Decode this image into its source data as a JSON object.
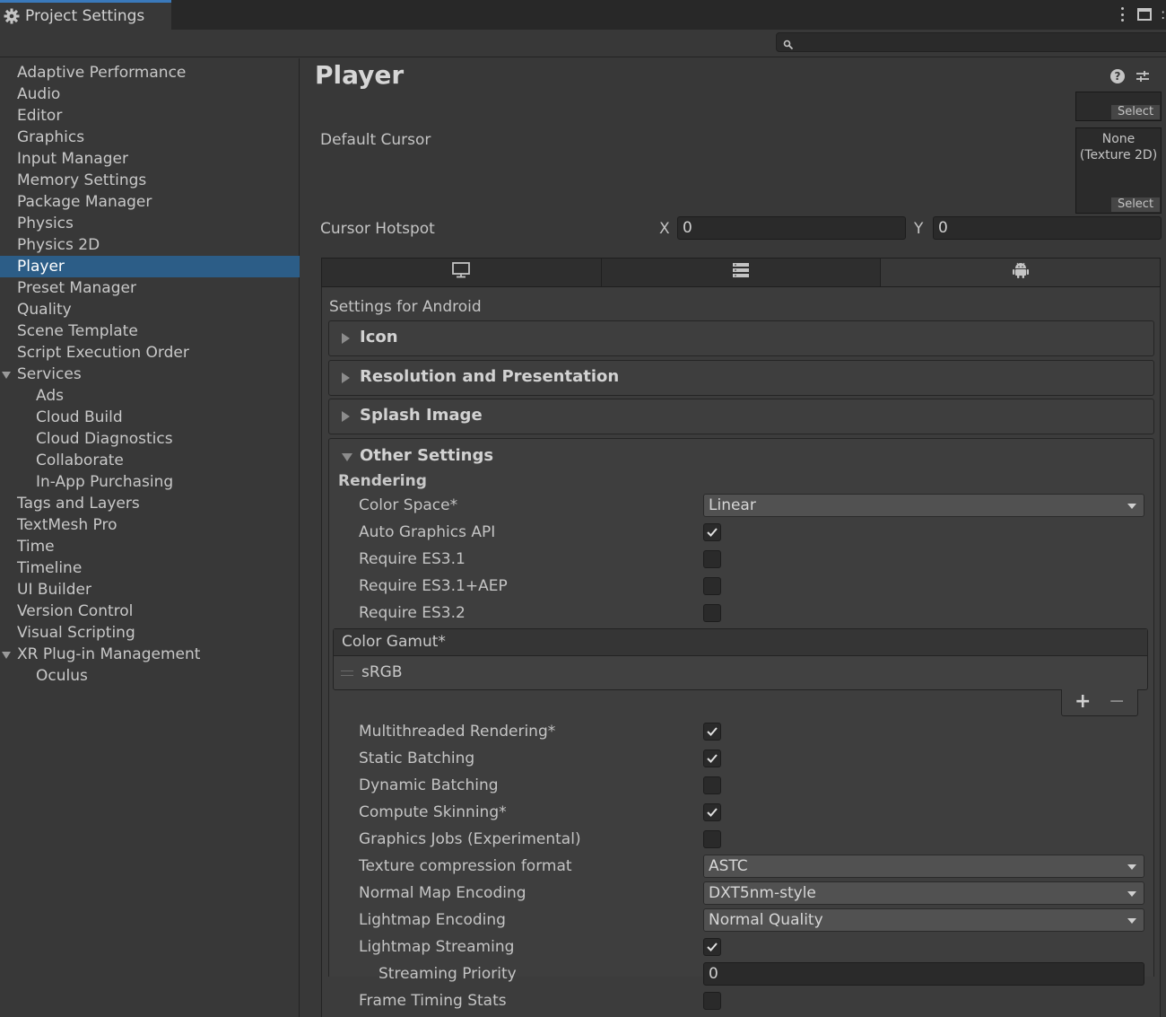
{
  "window": {
    "tab_title": "Project Settings",
    "search_placeholder": ""
  },
  "sidebar": {
    "items": [
      {
        "label": "Adaptive Performance"
      },
      {
        "label": "Audio"
      },
      {
        "label": "Editor"
      },
      {
        "label": "Graphics"
      },
      {
        "label": "Input Manager"
      },
      {
        "label": "Memory Settings"
      },
      {
        "label": "Package Manager"
      },
      {
        "label": "Physics"
      },
      {
        "label": "Physics 2D"
      },
      {
        "label": "Player",
        "selected": true
      },
      {
        "label": "Preset Manager"
      },
      {
        "label": "Quality"
      },
      {
        "label": "Scene Template"
      },
      {
        "label": "Script Execution Order"
      },
      {
        "label": "Services",
        "expanded": true
      },
      {
        "label": "Ads",
        "child": true
      },
      {
        "label": "Cloud Build",
        "child": true
      },
      {
        "label": "Cloud Diagnostics",
        "child": true
      },
      {
        "label": "Collaborate",
        "child": true
      },
      {
        "label": "In-App Purchasing",
        "child": true
      },
      {
        "label": "Tags and Layers"
      },
      {
        "label": "TextMesh Pro"
      },
      {
        "label": "Time"
      },
      {
        "label": "Timeline"
      },
      {
        "label": "UI Builder"
      },
      {
        "label": "Version Control"
      },
      {
        "label": "Visual Scripting"
      },
      {
        "label": "XR Plug-in Management",
        "expanded": true
      },
      {
        "label": "Oculus",
        "child": true
      }
    ]
  },
  "main": {
    "title": "Player",
    "help_glyph": "?",
    "top_texture": {
      "select_label": "Select"
    },
    "default_cursor": {
      "label": "Default Cursor",
      "texture_name": "None\n(Texture 2D)",
      "select_label": "Select"
    },
    "cursor_hotspot": {
      "label": "Cursor Hotspot",
      "x_label": "X",
      "x_value": "0",
      "y_label": "Y",
      "y_value": "0"
    },
    "platform_tabs": [
      {
        "name": "standalone",
        "icon": "monitor-icon"
      },
      {
        "name": "server",
        "icon": "server-icon"
      },
      {
        "name": "android",
        "icon": "android-icon",
        "active": true
      }
    ],
    "settings_for": "Settings for Android",
    "sections": {
      "icon": "Icon",
      "resolution": "Resolution and Presentation",
      "splash": "Splash Image",
      "other": "Other Settings"
    },
    "other_settings": {
      "rendering_header": "Rendering",
      "color_space": {
        "label": "Color Space*",
        "value": "Linear"
      },
      "auto_graphics_api": {
        "label": "Auto Graphics API",
        "checked": true
      },
      "require_es31": {
        "label": "Require ES3.1",
        "checked": false
      },
      "require_es31_aep": {
        "label": "Require ES3.1+AEP",
        "checked": false
      },
      "require_es32": {
        "label": "Require ES3.2",
        "checked": false
      },
      "color_gamut": {
        "header": "Color Gamut*",
        "items": [
          "sRGB"
        ],
        "add": "+",
        "remove": "−"
      },
      "multithreaded_rendering": {
        "label": "Multithreaded Rendering*",
        "checked": true
      },
      "static_batching": {
        "label": "Static Batching",
        "checked": true
      },
      "dynamic_batching": {
        "label": "Dynamic Batching",
        "checked": false
      },
      "compute_skinning": {
        "label": "Compute Skinning*",
        "checked": true
      },
      "graphics_jobs": {
        "label": "Graphics Jobs (Experimental)",
        "checked": false
      },
      "texture_compression": {
        "label": "Texture compression format",
        "value": "ASTC"
      },
      "normal_map_encoding": {
        "label": "Normal Map Encoding",
        "value": "DXT5nm-style"
      },
      "lightmap_encoding": {
        "label": "Lightmap Encoding",
        "value": "Normal Quality"
      },
      "lightmap_streaming": {
        "label": "Lightmap Streaming",
        "checked": true
      },
      "streaming_priority": {
        "label": "Streaming Priority",
        "value": "0"
      },
      "frame_timing_stats": {
        "label": "Frame Timing Stats",
        "checked": false
      }
    }
  },
  "colors": {
    "background": "#383838",
    "selection": "#2c5d87",
    "tab_accent": "#3a79bb"
  }
}
